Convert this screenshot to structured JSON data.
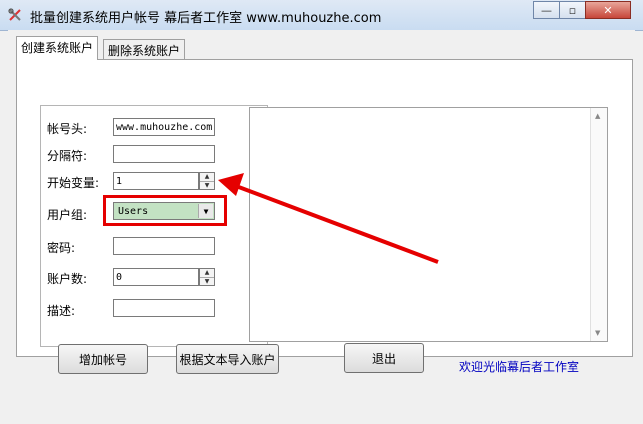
{
  "window": {
    "title": "批量创建系统用户帐号   幕后者工作室   www.muhouzhe.com",
    "controls": {
      "minimize": "—",
      "maximize": "▫",
      "close": "✕"
    }
  },
  "tabs": [
    {
      "label": "创建系统账户",
      "active": true
    },
    {
      "label": "删除系统账户",
      "active": false
    }
  ],
  "form": {
    "prefix_label": "帐号头:",
    "prefix_value": "www.muhouzhe.com",
    "separator_label": "分隔符:",
    "separator_value": "",
    "start_label": "开始变量:",
    "start_value": "1",
    "group_label": "用户组:",
    "group_value": "Users",
    "password_label": "密码:",
    "password_value": "",
    "count_label": "账户数:",
    "count_value": "0",
    "desc_label": "描述:",
    "desc_value": ""
  },
  "buttons": {
    "add": "增加帐号",
    "import": "根据文本导入账户",
    "exit": "退出"
  },
  "welcome_text": "欢迎光临幕后者工作室",
  "colors": {
    "annotation": "#e50000",
    "welcome": "#0000c0",
    "combo_bg": "#c3e2c3"
  }
}
